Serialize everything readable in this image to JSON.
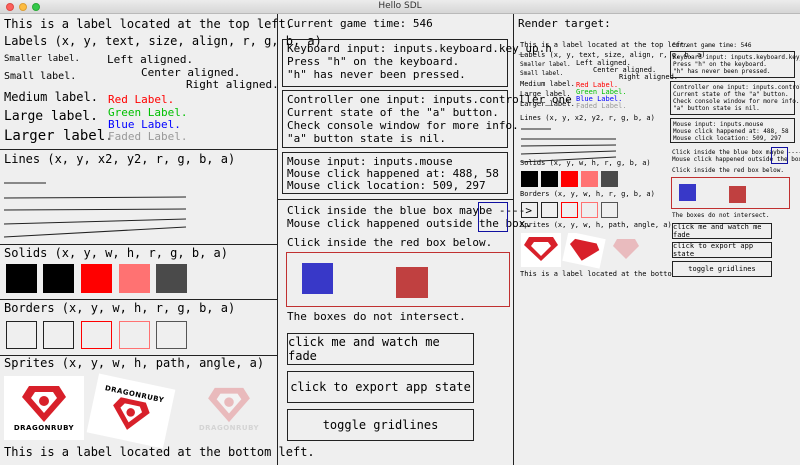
{
  "window": {
    "title": "Hello SDL"
  },
  "left": {
    "top_label": "This is a label located at the top left.",
    "labels_header": "Labels (x, y, text, size, align, r, g, b, a)",
    "smaller": "Smaller label.",
    "small": "Small label.",
    "medium": "Medium label.",
    "large": "Large label.",
    "larger": "Larger label.",
    "left_aligned": "Left aligned.",
    "center_aligned": "Center aligned.",
    "right_aligned": "Right aligned.",
    "red": "Red Label.",
    "green": "Green Label.",
    "blue": "Blue Label.",
    "faded": "Faded Label.",
    "lines_header": "Lines (x, y, x2, y2, r, g, b, a)",
    "solids_header": "Solids (x, y, w, h, r, g, b, a)",
    "borders_header": "Borders (x, y, w, h, r, g, b, a)",
    "sprites_header": "Sprites (x, y, w, h, path, angle, a)",
    "sprite_text": "DRAGONRUBY",
    "bottom_label": "This is a label located at the bottom left.",
    "colors": {
      "red": "#ff0000",
      "green": "#00c000",
      "blue": "#0000ff",
      "faded": "#999999"
    }
  },
  "middle": {
    "game_time": "Current game time: 546",
    "keyboard": [
      "Keyboard input: inputs.keyboard.key_up.h",
      "Press \"h\" on the keyboard.",
      "\"h\" has never been pressed."
    ],
    "controller": [
      "Controller one input: inputs.controller_one",
      "Current state of the \"a\" button.",
      "Check console window for more info.",
      "\"a\" button state is nil."
    ],
    "mouse": [
      "Mouse input: inputs.mouse",
      "Mouse click happened at: 488, 58",
      "Mouse click location: 509, 297"
    ],
    "blue_prompt": "Click inside the blue box maybe ---->",
    "blue_result": "Mouse click happened outside the box.",
    "red_prompt": "Click inside the red box below.",
    "intersect": "The boxes do not intersect.",
    "buttons": {
      "fade": "click me and watch me fade",
      "export": "click to export app state",
      "grid": "toggle gridlines"
    }
  },
  "render": {
    "title": "Render target:"
  }
}
